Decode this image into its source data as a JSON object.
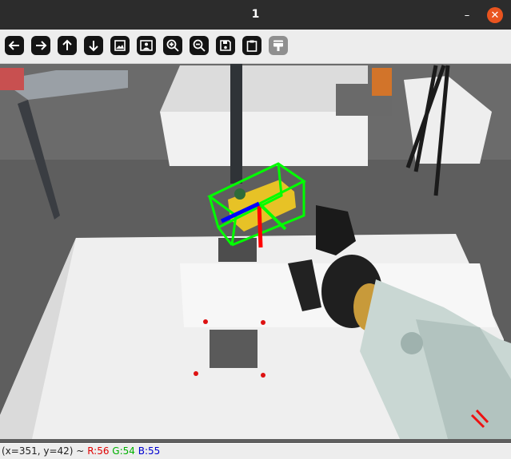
{
  "window": {
    "title": "1",
    "minimize_icon": "minimize-icon",
    "close_icon": "close-icon",
    "accent_close": "#e9541f"
  },
  "toolbar": {
    "buttons": [
      {
        "name": "pan-left-button",
        "icon": "arrow-left-icon"
      },
      {
        "name": "pan-right-button",
        "icon": "arrow-right-icon"
      },
      {
        "name": "pan-up-button",
        "icon": "arrow-up-icon"
      },
      {
        "name": "pan-down-button",
        "icon": "arrow-down-icon"
      },
      {
        "name": "zoom-fit-button",
        "icon": "image-fit-icon"
      },
      {
        "name": "zoom-original-button",
        "icon": "image-person-icon"
      },
      {
        "name": "zoom-in-button",
        "icon": "zoom-in-icon"
      },
      {
        "name": "zoom-out-button",
        "icon": "zoom-out-icon"
      },
      {
        "name": "save-button",
        "icon": "save-icon"
      },
      {
        "name": "copy-button",
        "icon": "clipboard-icon"
      },
      {
        "name": "properties-button",
        "icon": "paint-icon",
        "disabled": true
      }
    ]
  },
  "status": {
    "coords": "(x=351, y=42) ~",
    "r": "R:56",
    "g": "G:54",
    "b": "B:55"
  },
  "scene": {
    "box_color": "#00ff00",
    "axis_x_color": "#ff0000",
    "axis_y_color": "#00ff00",
    "axis_z_color": "#0000ff"
  }
}
